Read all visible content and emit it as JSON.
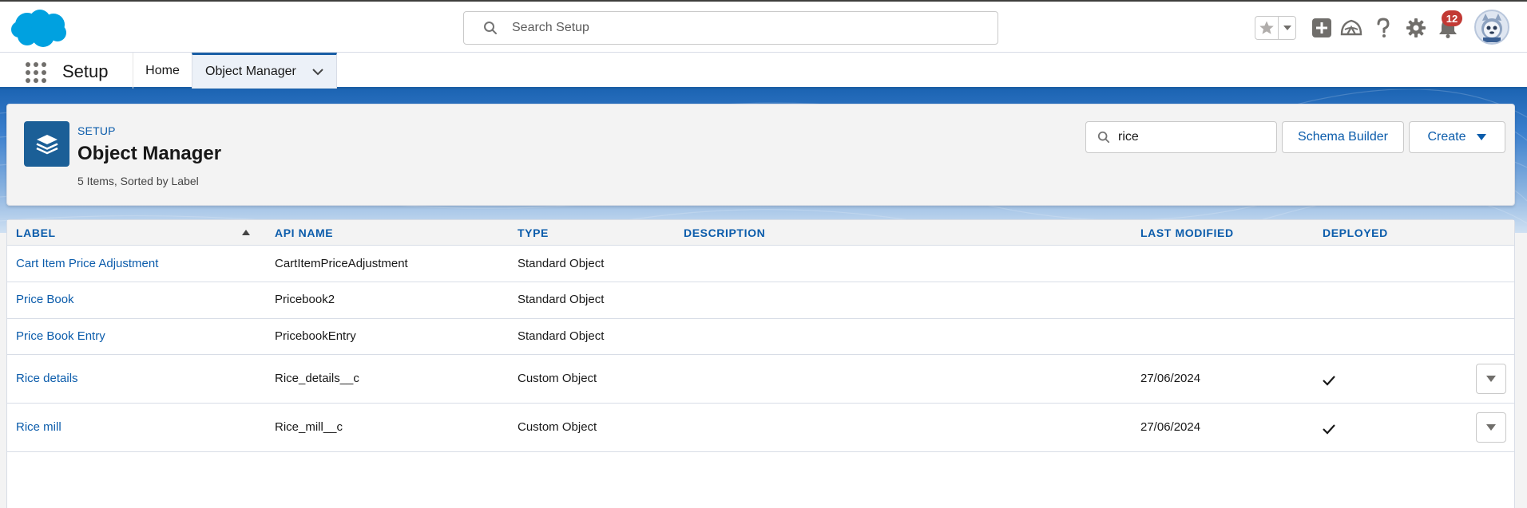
{
  "global_header": {
    "search_placeholder": "Search Setup",
    "notifications_count": "12"
  },
  "context_bar": {
    "app_name": "Setup",
    "tabs": [
      {
        "label": "Home"
      },
      {
        "label": "Object Manager",
        "active": true
      }
    ]
  },
  "page_header": {
    "eyebrow": "SETUP",
    "title": "Object Manager",
    "meta": "5 Items, Sorted by Label",
    "search_value": "rice",
    "schema_builder_label": "Schema Builder",
    "create_label": "Create"
  },
  "table": {
    "columns": [
      "LABEL",
      "API NAME",
      "TYPE",
      "DESCRIPTION",
      "LAST MODIFIED",
      "DEPLOYED"
    ],
    "sorted_by": "LABEL",
    "sort_direction": "ascending",
    "rows": [
      {
        "label": "Cart Item Price Adjustment",
        "api_name": "CartItemPriceAdjustment",
        "type": "Standard Object",
        "description": "",
        "last_modified": "",
        "deployed": false
      },
      {
        "label": "Price Book",
        "api_name": "Pricebook2",
        "type": "Standard Object",
        "description": "",
        "last_modified": "",
        "deployed": false
      },
      {
        "label": "Price Book Entry",
        "api_name": "PricebookEntry",
        "type": "Standard Object",
        "description": "",
        "last_modified": "",
        "deployed": false
      },
      {
        "label": "Rice details",
        "api_name": "Rice_details__c",
        "type": "Custom Object",
        "description": "",
        "last_modified": "27/06/2024",
        "deployed": true
      },
      {
        "label": "Rice mill",
        "api_name": "Rice_mill__c",
        "type": "Custom Object",
        "description": "",
        "last_modified": "27/06/2024",
        "deployed": true
      }
    ]
  },
  "colors": {
    "brand_blue": "#0b5cab",
    "salesforce_cloud": "#00a1e0",
    "header_band": "#1c64b3",
    "badge_red": "#c23934"
  },
  "icons": [
    "salesforce-logo",
    "search-icon",
    "star-icon",
    "chevron-down-icon",
    "add-icon",
    "trailhead-icon",
    "help-icon",
    "gear-icon",
    "bell-icon",
    "avatar",
    "app-launcher-icon",
    "layers-icon",
    "sort-up-icon",
    "check-icon"
  ]
}
